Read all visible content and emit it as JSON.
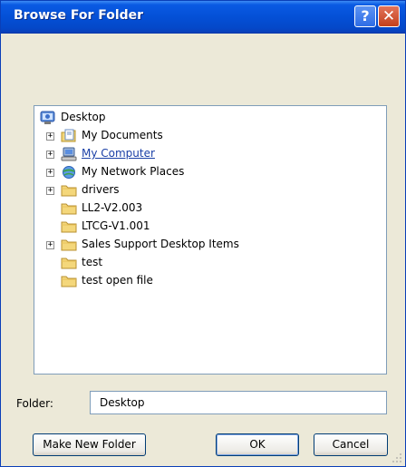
{
  "window": {
    "title": "Browse For Folder",
    "help_glyph": "?",
    "close_glyph": "✕"
  },
  "tree": {
    "items": [
      {
        "label": "Desktop",
        "icon": "desktop-icon",
        "expandable": false,
        "level": 0
      },
      {
        "label": "My Documents",
        "icon": "documents-icon",
        "expandable": true,
        "level": 1
      },
      {
        "label": "My Computer",
        "icon": "computer-icon",
        "expandable": true,
        "level": 1
      },
      {
        "label": "My Network Places",
        "icon": "network-icon",
        "expandable": true,
        "level": 1
      },
      {
        "label": "drivers",
        "icon": "folder-icon",
        "expandable": true,
        "level": 1
      },
      {
        "label": "LL2-V2.003",
        "icon": "folder-icon",
        "expandable": false,
        "level": 1
      },
      {
        "label": "LTCG-V1.001",
        "icon": "folder-icon",
        "expandable": false,
        "level": 1
      },
      {
        "label": "Sales Support Desktop Items",
        "icon": "folder-icon",
        "expandable": true,
        "level": 1
      },
      {
        "label": "test",
        "icon": "folder-icon",
        "expandable": false,
        "level": 1
      },
      {
        "label": "test open file",
        "icon": "folder-icon",
        "expandable": false,
        "level": 1
      }
    ],
    "expand_glyph": "+"
  },
  "folder": {
    "label": "Folder:",
    "value": "Desktop"
  },
  "buttons": {
    "make_new_folder": "Make New Folder",
    "ok": "OK",
    "cancel": "Cancel"
  },
  "colors": {
    "title_bar": "#0450d6",
    "window_bg": "#ece9d8",
    "tree_border": "#7f9db9",
    "selected_link": "#1a3fa6"
  }
}
